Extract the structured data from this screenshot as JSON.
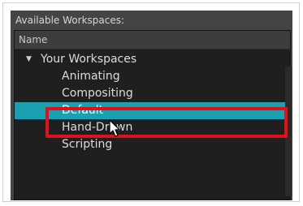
{
  "panel": {
    "title": "Available Workspaces:",
    "column_header": "Name",
    "tree": {
      "group_label": "Your Workspaces",
      "items": [
        {
          "label": "Animating"
        },
        {
          "label": "Compositing"
        },
        {
          "label": "Default"
        },
        {
          "label": "Hand-Drawn"
        },
        {
          "label": "Scripting"
        }
      ]
    }
  },
  "colors": {
    "selection": "#1b9fb1",
    "highlight_box": "#e0111a",
    "panel_bg": "#444444",
    "list_bg": "#1f1f1f"
  },
  "icons": {
    "expander": "triangle-down-icon",
    "cursor": "mouse-pointer-icon"
  }
}
